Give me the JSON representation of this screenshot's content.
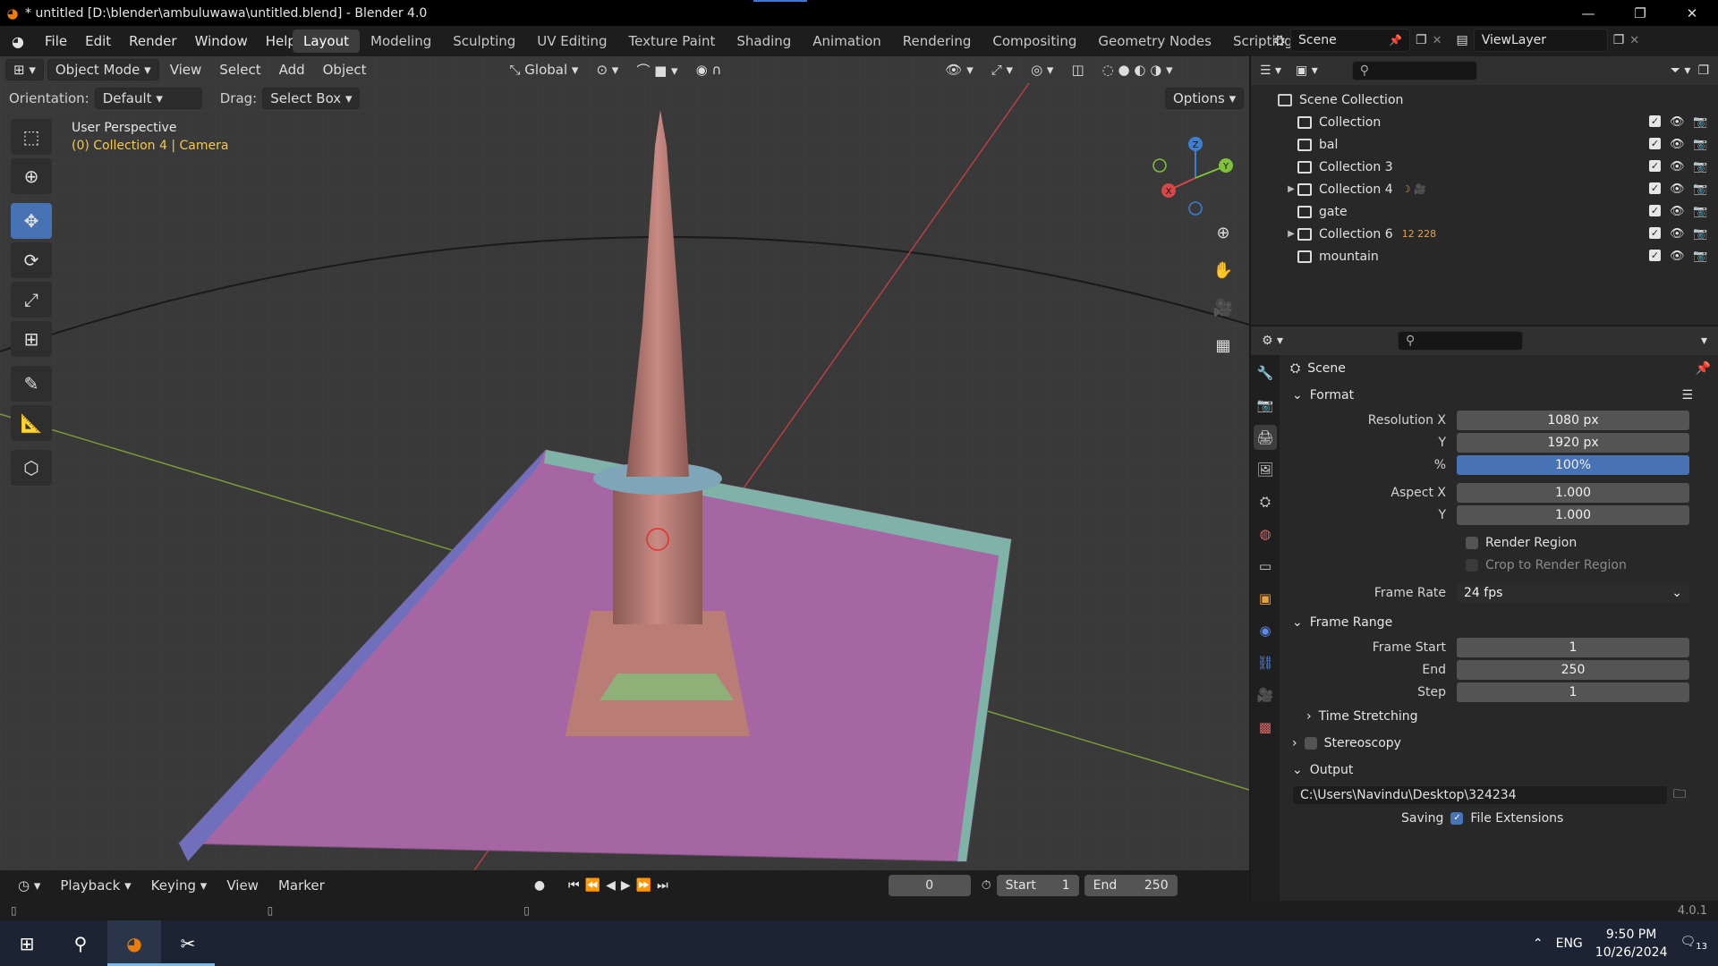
{
  "titlebar": {
    "title": "* untitled [D:\\blender\\ambuluwawa\\untitled.blend] - Blender 4.0",
    "minimize": "—",
    "maximize": "❐",
    "close": "✕"
  },
  "menu": [
    "File",
    "Edit",
    "Render",
    "Window",
    "Help"
  ],
  "workspaces": [
    "Layout",
    "Modeling",
    "Sculpting",
    "UV Editing",
    "Texture Paint",
    "Shading",
    "Animation",
    "Rendering",
    "Compositing",
    "Geometry Nodes",
    "Scripting"
  ],
  "active_workspace": "Layout",
  "scene": {
    "name": "Scene",
    "view_layer": "ViewLayer"
  },
  "viewport": {
    "mode": "Object Mode",
    "menus": [
      "View",
      "Select",
      "Add",
      "Object"
    ],
    "transform_orientation": "Global",
    "orientation_label": "Orientation:",
    "orientation_value": "Default",
    "drag_label": "Drag:",
    "drag_value": "Select Box",
    "options": "Options",
    "perspective": "User Perspective",
    "collection_info": "(0) Collection 4 | Camera",
    "gizmo": {
      "x": "X",
      "y": "Y",
      "z": "Z"
    }
  },
  "outliner": {
    "root": "Scene Collection",
    "items": [
      {
        "name": "Collection",
        "expandable": false,
        "badge": ""
      },
      {
        "name": "bal",
        "expandable": false,
        "badge": ""
      },
      {
        "name": "Collection 3",
        "expandable": false,
        "badge": ""
      },
      {
        "name": "Collection 4",
        "expandable": true,
        "badge": ""
      },
      {
        "name": "gate",
        "expandable": false,
        "badge": ""
      },
      {
        "name": "Collection 6",
        "expandable": true,
        "badge": "12 228"
      },
      {
        "name": "mountain",
        "expandable": false,
        "badge": ""
      }
    ]
  },
  "properties": {
    "context": "Scene",
    "format": {
      "title": "Format",
      "resolution_x_label": "Resolution X",
      "resolution_x": "1080 px",
      "resolution_y_label": "Y",
      "resolution_y": "1920 px",
      "percent_label": "%",
      "percent": "100%",
      "aspect_x_label": "Aspect X",
      "aspect_x": "1.000",
      "aspect_y_label": "Y",
      "aspect_y": "1.000",
      "render_region": "Render Region",
      "crop_region": "Crop to Render Region",
      "frame_rate_label": "Frame Rate",
      "frame_rate": "24 fps"
    },
    "frame_range": {
      "title": "Frame Range",
      "start_label": "Frame Start",
      "start": "1",
      "end_label": "End",
      "end": "250",
      "step_label": "Step",
      "step": "1",
      "time_stretching": "Time Stretching"
    },
    "stereoscopy": "Stereoscopy",
    "output": {
      "title": "Output",
      "path": "C:\\Users\\Navindu\\Desktop\\324234",
      "saving_label": "Saving",
      "file_extensions": "File Extensions"
    }
  },
  "timeline": {
    "menus": [
      "Playback",
      "Keying",
      "View",
      "Marker"
    ],
    "current_frame": "0",
    "start_label": "Start",
    "start": "1",
    "end_label": "End",
    "end": "250"
  },
  "status": {
    "version": "4.0.1"
  },
  "taskbar": {
    "language": "ENG",
    "time": "9:50 PM",
    "date": "10/26/2024",
    "notifications": "13"
  }
}
